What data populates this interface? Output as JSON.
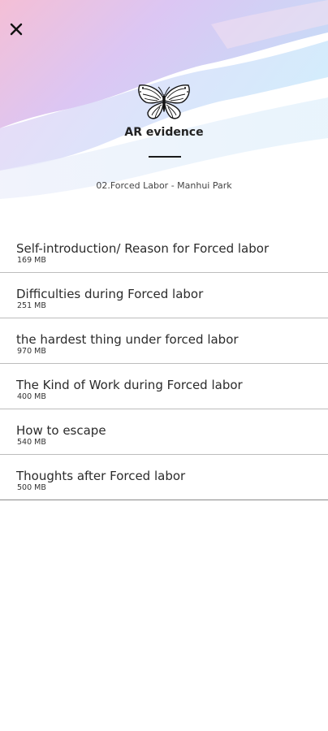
{
  "header": {
    "title": "AR evidence",
    "subtitle": "02.Forced Labor - Manhui Park",
    "close_icon": "close-icon",
    "logo_icon": "butterfly-icon",
    "gradient_colors": [
      "#f3bfd8",
      "#d7c3f2",
      "#c3d2f5",
      "#cfe6fb",
      "#ffffff"
    ]
  },
  "items": [
    {
      "title": "Self-introduction/ Reason for Forced labor",
      "size": "169 MB"
    },
    {
      "title": "Difficulties during Forced labor",
      "size": "251 MB"
    },
    {
      "title": "the hardest thing under forced labor",
      "size": "970 MB"
    },
    {
      "title": "The Kind of Work during Forced labor",
      "size": "400 MB"
    },
    {
      "title": "How to escape",
      "size": "540 MB"
    },
    {
      "title": "Thoughts after Forced labor",
      "size": "500 MB"
    }
  ]
}
